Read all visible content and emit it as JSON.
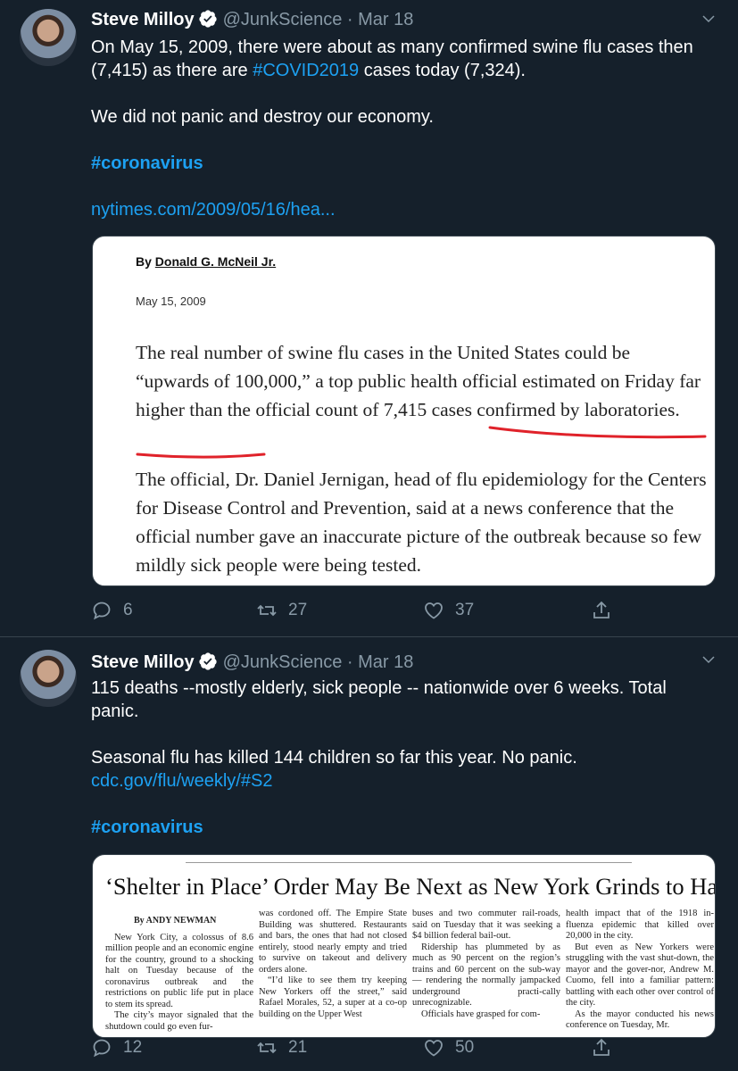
{
  "tweets": [
    {
      "name": "Steve Milloy",
      "handle": "@JunkScience",
      "sep": "·",
      "date": "Mar 18",
      "line1_a": "On May 15, 2009, there were about as many confirmed swine flu cases then (7,415) as there are ",
      "line1_tag": "#COVID2019",
      "line1_b": " cases today (7,324).",
      "line2": "We did not panic and destroy our economy.",
      "hashtag": "#coronavirus",
      "link": "nytimes.com/2009/05/16/hea...",
      "article": {
        "by_prefix": "By ",
        "byline": "Donald G. McNeil Jr.",
        "date": "May 15, 2009",
        "para1": "The real number of swine flu cases in the United States could be “upwards of 100,000,” a top public health official estimated on Friday  far higher than the official count of 7,415 cases confirmed by laboratories.",
        "para2": "The official, Dr. Daniel Jernigan, head of flu epidemiology for the Centers for Disease Control and Prevention, said at a news conference that the official number gave an inaccurate picture of the outbreak because so few mildly sick people were being tested."
      },
      "replies": "6",
      "retweets": "27",
      "likes": "37"
    },
    {
      "name": "Steve Milloy",
      "handle": "@JunkScience",
      "sep": "·",
      "date": "Mar 18",
      "line1": "115 deaths --mostly elderly, sick people -- nationwide over 6 weeks. Total panic.",
      "line2": "Seasonal flu has killed 144 children so far this year. No panic.",
      "link": "cdc.gov/flu/weekly/#S2",
      "hashtag": "#coronavirus",
      "article": {
        "headline": "‘Shelter in Place’ Order May Be Next as New York Grinds to Halt",
        "byline": "By ANDY NEWMAN",
        "col1": "New York City, a colossus of 8.6 million people and an economic engine for the country, ground to a shocking halt on Tuesday because of the coronavirus outbreak and the restrictions on public life put in place to stem its spread.",
        "col1b": "The city’s mayor signaled that the shutdown could go even fur-",
        "col2a": "was cordoned off. The Empire State Building was shuttered. Restaurants and bars, the ones that had not closed entirely, stood nearly empty and tried to survive on takeout and delivery orders alone.",
        "col2b": "“I’d like to see them try keeping New Yorkers off the street,” said Rafael Morales, 52, a super at a co-op building on the Upper West",
        "col3a": "buses and two commuter rail-roads, said on Tuesday that it was seeking a $4 billion federal bail-out.",
        "col3b": "Ridership has plummeted by as much as 90 percent on the region’s trains and 60 percent on the sub-way — rendering the normally jampacked underground practi-cally unrecognizable.",
        "col3c": "Officials have grasped for com-",
        "col4a": "health impact that of the 1918 in-fluenza epidemic that killed over 20,000 in the city.",
        "col4b": "But even as New Yorkers were struggling with the vast shut-down, the mayor and the gover-nor, Andrew M. Cuomo, fell into a familiar pattern: battling with each other over control of the city.",
        "col4c": "As the mayor conducted his news conference on Tuesday, Mr."
      },
      "replies": "12",
      "retweets": "21",
      "likes": "50"
    }
  ],
  "icons": [
    "avatar",
    "verified-badge-icon",
    "chevron-down-icon",
    "reply-icon",
    "retweet-icon",
    "like-icon",
    "share-icon"
  ],
  "colors": {
    "background": "#15202b",
    "link": "#1da1f2",
    "muted": "#8899a6",
    "underline": "#e0222a"
  }
}
